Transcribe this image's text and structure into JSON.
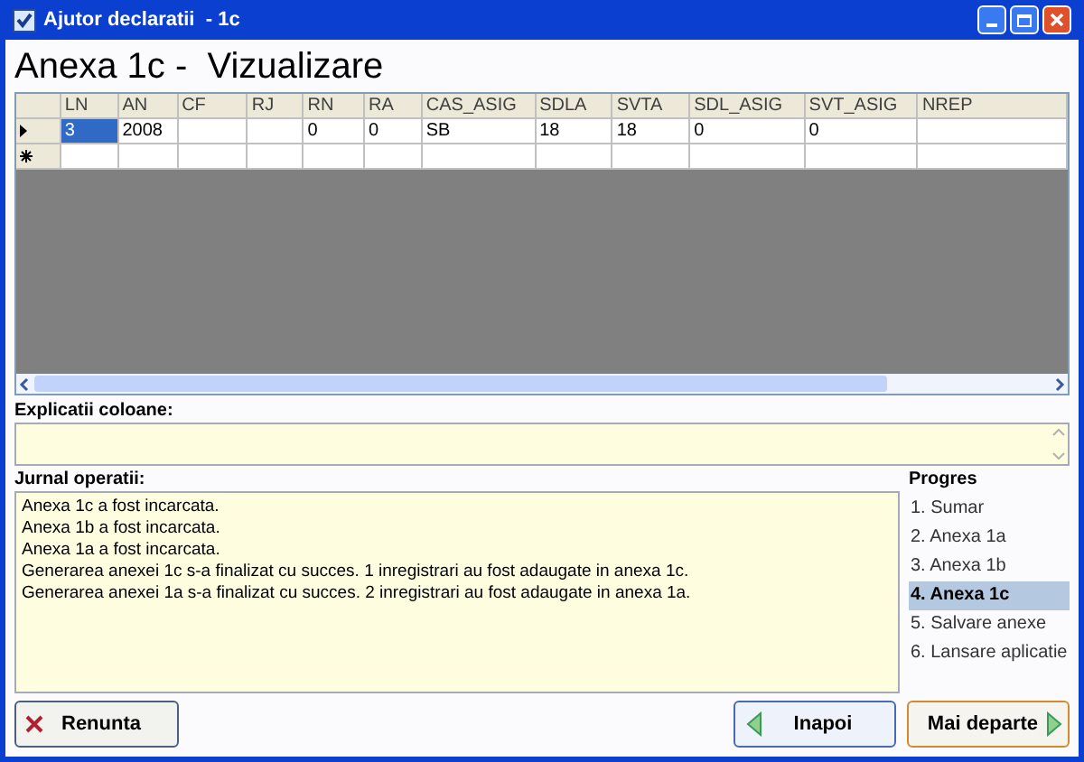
{
  "window": {
    "title": "Ajutor declaratii  - 1c"
  },
  "heading": "Anexa 1c -  Vizualizare",
  "grid": {
    "columns": [
      "LN",
      "AN",
      "CF",
      "RJ",
      "RN",
      "RA",
      "CAS_ASIG",
      "SDLA",
      "SVTA",
      "SDL_ASIG",
      "SVT_ASIG",
      "NREP"
    ],
    "rows": [
      {
        "kind": "current",
        "cells": [
          {
            "text": "3",
            "selected": true
          },
          {
            "text": "2008",
            "selected": false
          },
          {
            "text": "",
            "selected": false
          },
          {
            "text": "",
            "selected": false
          },
          {
            "text": "0",
            "selected": false
          },
          {
            "text": "0",
            "selected": false
          },
          {
            "text": "SB",
            "selected": false
          },
          {
            "text": "18",
            "selected": false
          },
          {
            "text": "18",
            "selected": false
          },
          {
            "text": "0",
            "selected": false
          },
          {
            "text": "0",
            "selected": false
          },
          {
            "text": "",
            "selected": false
          }
        ]
      },
      {
        "kind": "new",
        "cells": [
          {
            "text": "",
            "selected": false
          },
          {
            "text": "",
            "selected": false
          },
          {
            "text": "",
            "selected": false
          },
          {
            "text": "",
            "selected": false
          },
          {
            "text": "",
            "selected": false
          },
          {
            "text": "",
            "selected": false
          },
          {
            "text": "",
            "selected": false
          },
          {
            "text": "",
            "selected": false
          },
          {
            "text": "",
            "selected": false
          },
          {
            "text": "",
            "selected": false
          },
          {
            "text": "",
            "selected": false
          },
          {
            "text": "",
            "selected": false
          }
        ]
      }
    ]
  },
  "explanations": {
    "label": "Explicatii coloane:"
  },
  "log": {
    "label": "Jurnal operatii:",
    "lines": [
      "Anexa 1c a fost incarcata.",
      "Anexa 1b a fost incarcata.",
      "Anexa 1a a fost incarcata.",
      "Generarea anexei 1c s-a finalizat cu succes. 1 inregistrari au fost adaugate in anexa 1c.",
      "Generarea anexei 1a s-a finalizat cu succes. 2 inregistrari au fost adaugate in anexa 1a."
    ]
  },
  "progress": {
    "label": "Progres",
    "steps": [
      {
        "label": "1. Sumar",
        "selected": false
      },
      {
        "label": "2. Anexa 1a",
        "selected": false
      },
      {
        "label": "3. Anexa 1b",
        "selected": false
      },
      {
        "label": "4. Anexa 1c",
        "selected": true
      },
      {
        "label": "5. Salvare anexe",
        "selected": false
      },
      {
        "label": "6. Lansare aplicatie",
        "selected": false
      }
    ]
  },
  "buttons": {
    "cancel": "Renunta",
    "back": "Inapoi",
    "next": "Mai departe"
  }
}
